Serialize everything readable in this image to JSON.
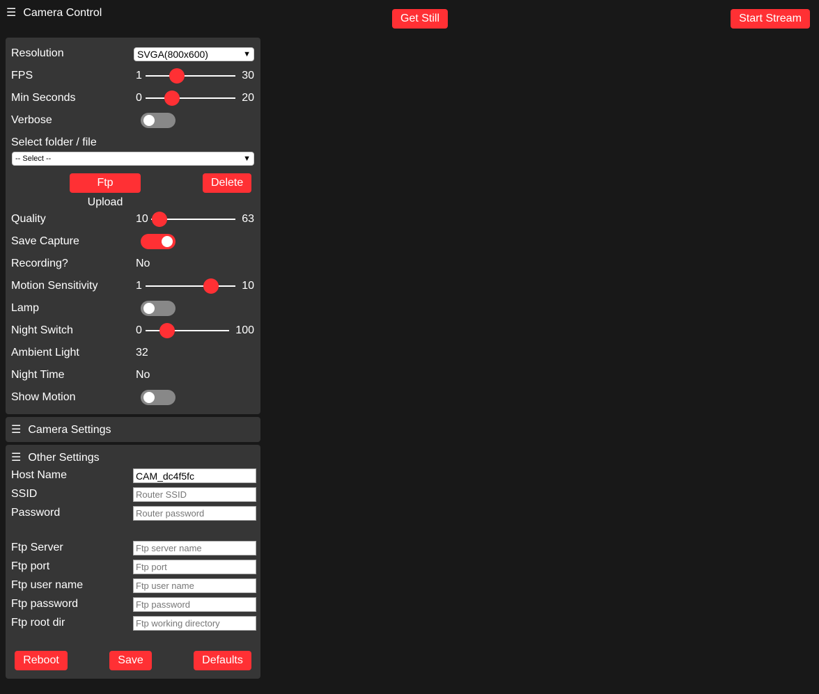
{
  "header": {
    "title": "Camera Control",
    "get_still": "Get Still",
    "start_stream": "Start Stream"
  },
  "controls": {
    "resolution": {
      "label": "Resolution",
      "value": "SVGA(800x600)"
    },
    "fps": {
      "label": "FPS",
      "min": "1",
      "max": "30"
    },
    "min_seconds": {
      "label": "Min Seconds",
      "min": "0",
      "max": "20"
    },
    "verbose": {
      "label": "Verbose",
      "on": false
    },
    "select_file": {
      "label": "Select folder / file",
      "value": "-- Select --"
    },
    "ftp_upload": "Ftp Upload",
    "delete": "Delete",
    "quality": {
      "label": "Quality",
      "min": "10",
      "max": "63"
    },
    "save_capture": {
      "label": "Save Capture",
      "on": true
    },
    "recording": {
      "label": "Recording?",
      "value": "No"
    },
    "motion_sensitivity": {
      "label": "Motion Sensitivity",
      "min": "1",
      "max": "10"
    },
    "lamp": {
      "label": "Lamp",
      "on": false
    },
    "night_switch": {
      "label": "Night Switch",
      "min": "0",
      "max": "100"
    },
    "ambient_light": {
      "label": "Ambient Light",
      "value": "32"
    },
    "night_time": {
      "label": "Night Time",
      "value": "No"
    },
    "show_motion": {
      "label": "Show Motion",
      "on": false
    }
  },
  "camera_settings": {
    "title": "Camera Settings"
  },
  "other_settings": {
    "title": "Other Settings",
    "host_name": {
      "label": "Host Name",
      "value": "CAM_dc4f5fc"
    },
    "ssid": {
      "label": "SSID",
      "placeholder": "Router SSID"
    },
    "password": {
      "label": "Password",
      "placeholder": "Router password"
    },
    "ftp_server": {
      "label": "Ftp Server",
      "placeholder": "Ftp server name"
    },
    "ftp_port": {
      "label": "Ftp port",
      "placeholder": "Ftp port"
    },
    "ftp_user": {
      "label": "Ftp user name",
      "placeholder": "Ftp user name"
    },
    "ftp_password": {
      "label": "Ftp password",
      "placeholder": "Ftp password"
    },
    "ftp_root": {
      "label": "Ftp root dir",
      "placeholder": "Ftp working directory"
    },
    "reboot": "Reboot",
    "save": "Save",
    "defaults": "Defaults"
  },
  "icons": {
    "menu": "hamburger-menu-icon",
    "dropdown": "chevron-down-icon"
  },
  "colors": {
    "accent": "#ff3034",
    "background": "#181818",
    "panel": "#363636"
  }
}
